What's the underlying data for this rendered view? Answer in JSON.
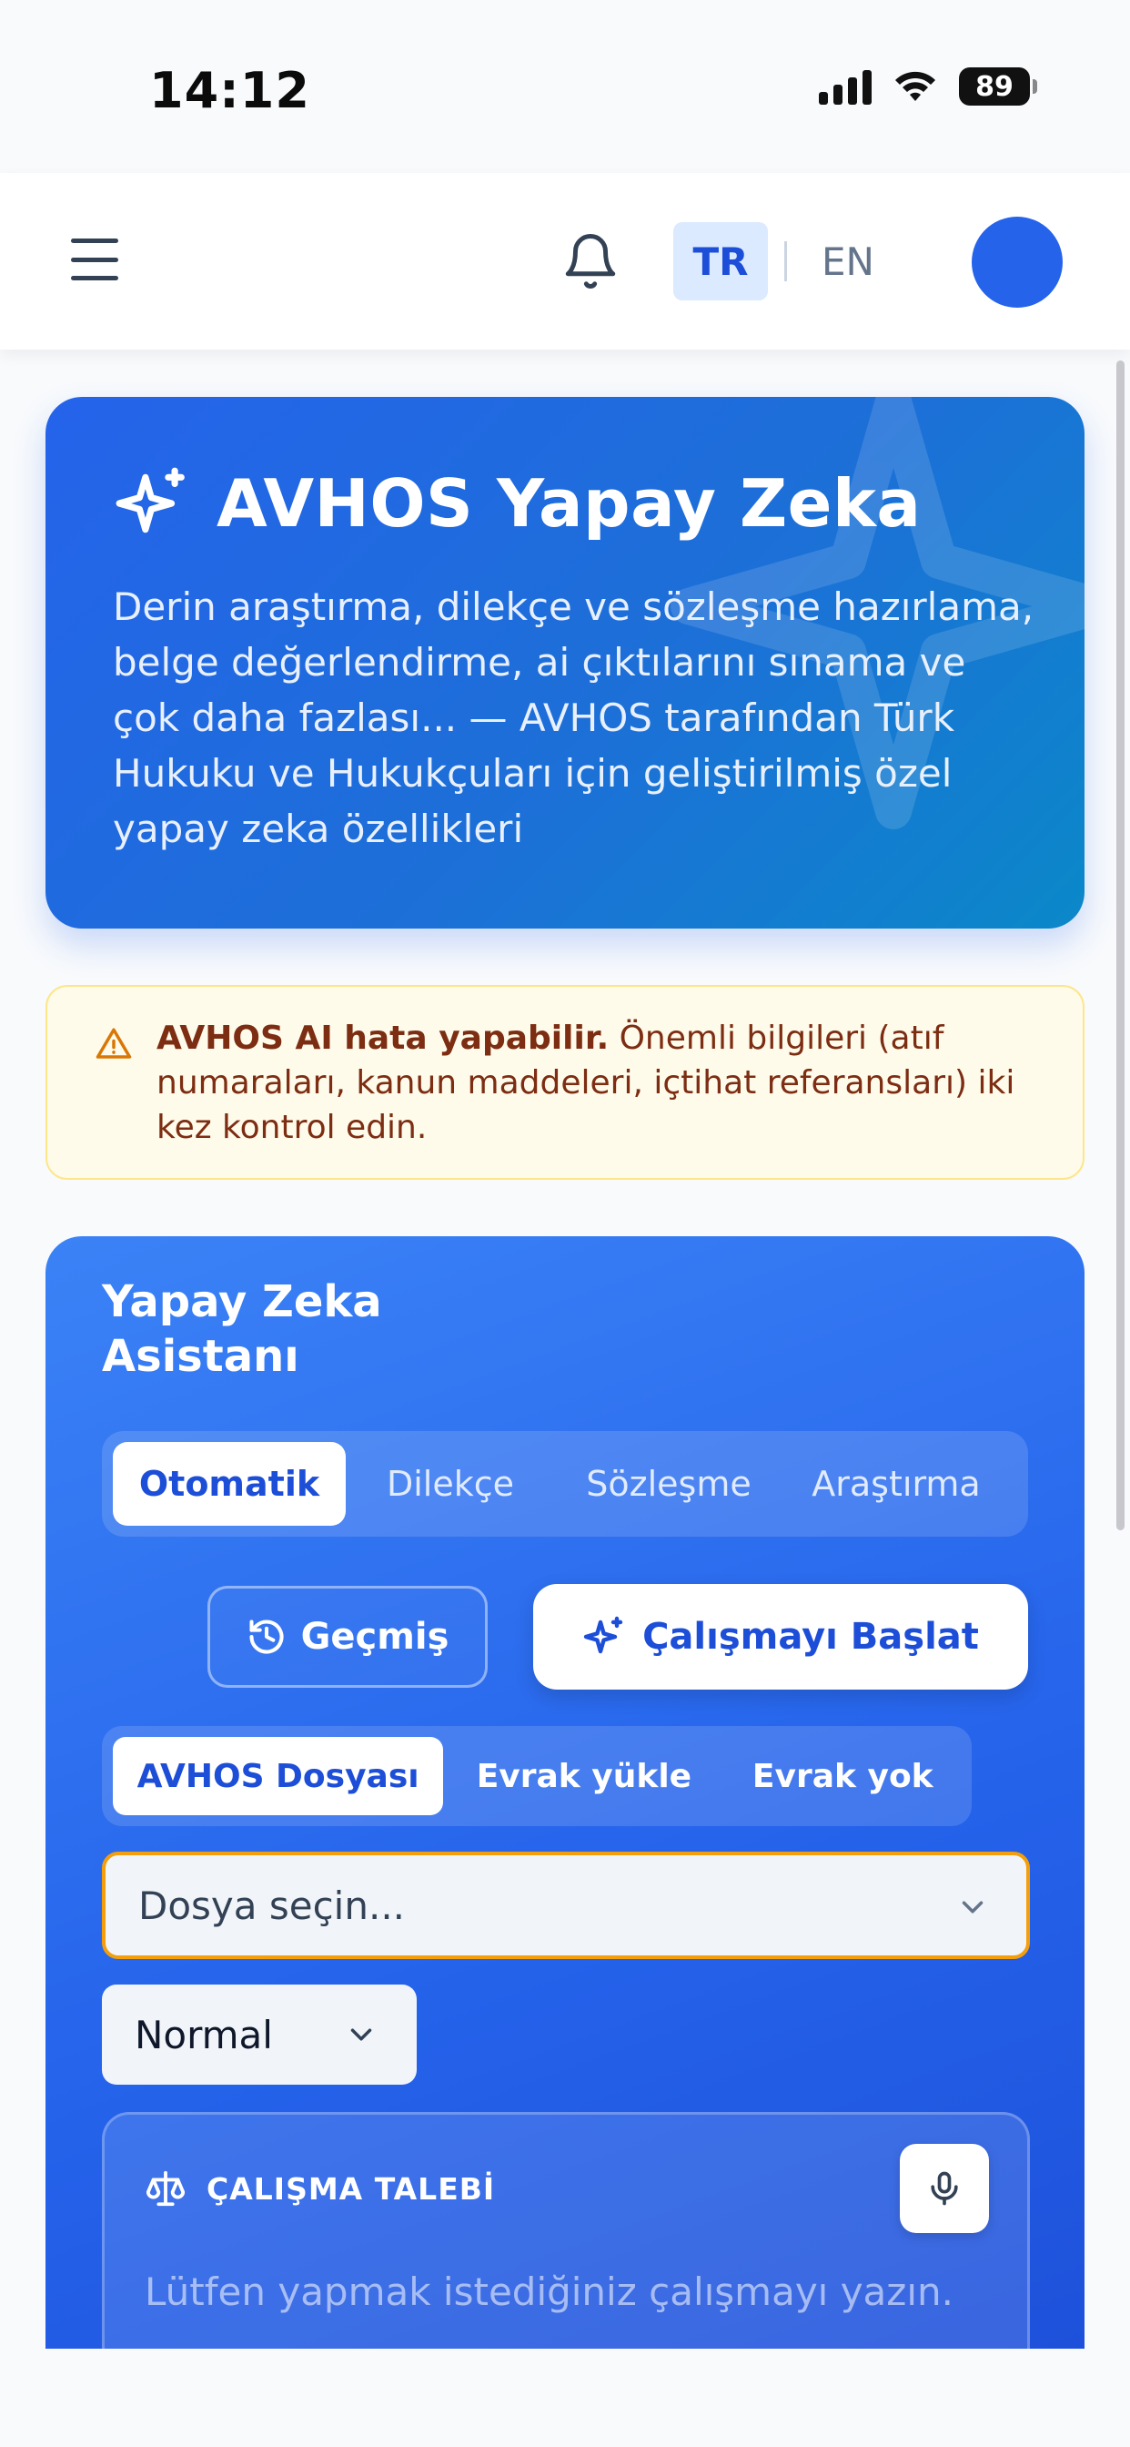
{
  "status_bar": {
    "time": "14:12",
    "battery": "89"
  },
  "header": {
    "lang_tr": "TR",
    "lang_en": "EN"
  },
  "hero": {
    "title": "AVHOS Yapay Zeka",
    "description": "Derin araştırma, dilekçe ve sözleşme hazırlama, belge değerlendirme, ai çıktılarını sınama ve çok daha fazlası... — AVHOS tarafından Türk Hukuku ve Hukukçuları için geliştirilmiş özel yapay zeka özellikleri"
  },
  "warning": {
    "bold": "AVHOS AI hata yapabilir.",
    "text": " Önemli bilgileri (atıf numaraları, kanun maddeleri, içtihat referansları) iki kez kontrol edin."
  },
  "assistant": {
    "title": "Yapay Zeka Asistanı",
    "mode_tabs": [
      {
        "label": "Otomatik",
        "active": true
      },
      {
        "label": "Dilekçe",
        "active": false
      },
      {
        "label": "Sözleşme",
        "active": false
      },
      {
        "label": "Araştırma",
        "active": false
      }
    ],
    "history_button": "Geçmiş",
    "start_button": "Çalışmayı Başlat",
    "source_tabs": [
      {
        "label": "AVHOS Dosyası",
        "active": true
      },
      {
        "label": "Evrak yükle",
        "active": false
      },
      {
        "label": "Evrak yok",
        "active": false
      }
    ],
    "file_select_placeholder": "Dosya seçin...",
    "mode_select_value": "Normal",
    "request": {
      "label": "ÇALIŞMA TALEBİ",
      "placeholder": "Lütfen yapmak istediğiniz çalışmayı yazın."
    }
  },
  "colors": {
    "primary": "#2563eb",
    "warning_bg": "#fffbeb",
    "warning_border": "#fde68a",
    "warning_text": "#7c2d12",
    "focus_border": "#f59e0b"
  }
}
